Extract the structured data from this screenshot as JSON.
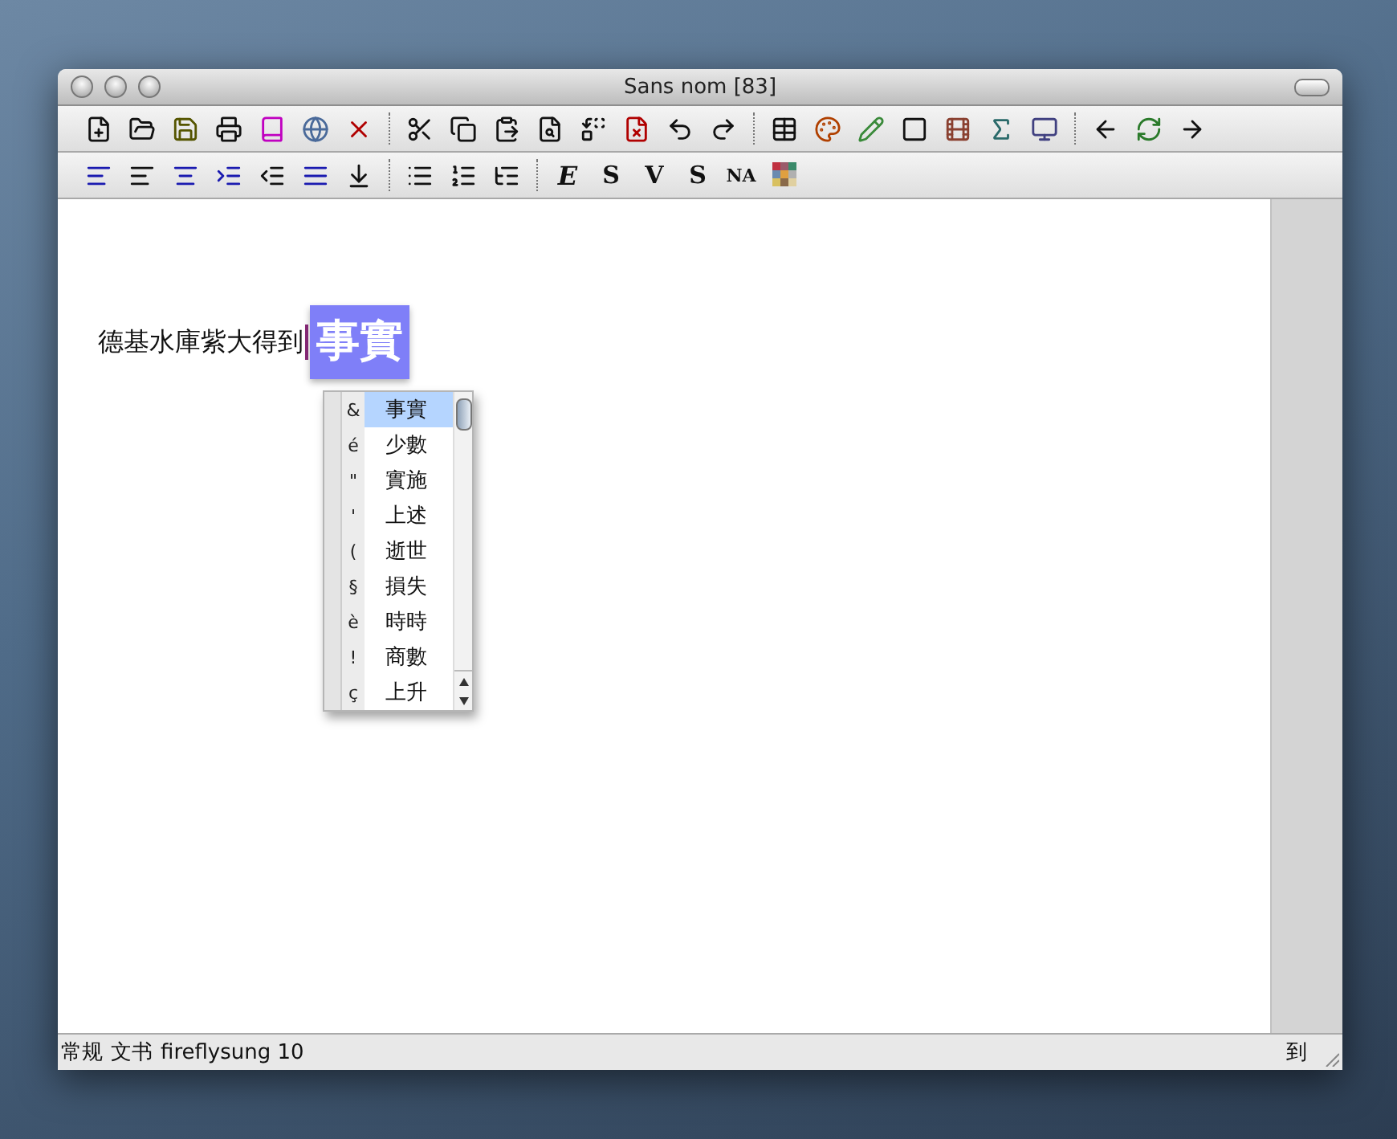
{
  "window": {
    "title": "Sans nom [83]"
  },
  "format_toolbar": {
    "text_buttons": [
      "E",
      "S",
      "V",
      "S",
      "NA"
    ]
  },
  "document": {
    "text": "德基水庫紫大得到",
    "composition": "事實"
  },
  "candidates": [
    {
      "key": "&",
      "word": "事實",
      "selected": true
    },
    {
      "key": "é",
      "word": "少數",
      "selected": false
    },
    {
      "key": "\"",
      "word": "實施",
      "selected": false
    },
    {
      "key": "'",
      "word": "上述",
      "selected": false
    },
    {
      "key": "(",
      "word": "逝世",
      "selected": false
    },
    {
      "key": "§",
      "word": "損失",
      "selected": false
    },
    {
      "key": "è",
      "word": "時時",
      "selected": false
    },
    {
      "key": "!",
      "word": "商數",
      "selected": false
    },
    {
      "key": "ç",
      "word": "上升",
      "selected": false
    }
  ],
  "status_bar": {
    "style": "常规",
    "mode": "文书",
    "font": "fireflysung 10",
    "indicator": "到"
  }
}
